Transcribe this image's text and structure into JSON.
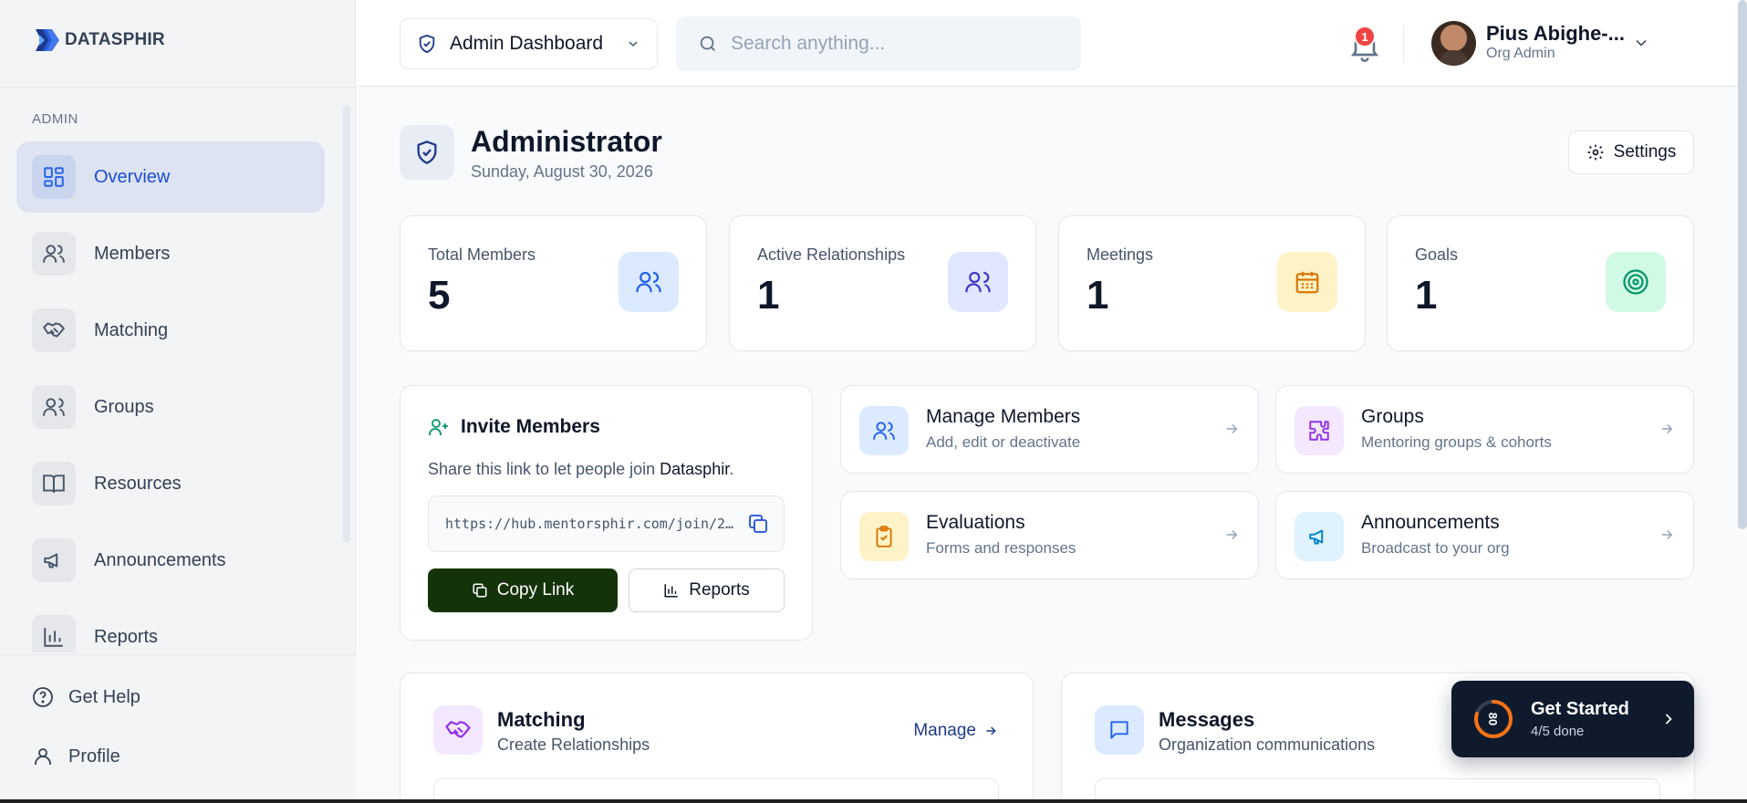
{
  "brand": {
    "name": "DATASPHIR",
    "colors": {
      "primary": "#1d4ed8",
      "dark_green": "#14330a",
      "navy": "#0f1b2d"
    }
  },
  "sidebar": {
    "section_label": "ADMIN",
    "items": [
      {
        "label": "Overview",
        "icon": "grid-icon",
        "active": true
      },
      {
        "label": "Members",
        "icon": "users-icon",
        "active": false
      },
      {
        "label": "Matching",
        "icon": "handshake-icon",
        "active": false
      },
      {
        "label": "Groups",
        "icon": "group-icon",
        "active": false
      },
      {
        "label": "Resources",
        "icon": "book-icon",
        "active": false
      },
      {
        "label": "Announcements",
        "icon": "megaphone-icon",
        "active": false
      },
      {
        "label": "Reports",
        "icon": "bar-chart-icon",
        "active": false
      }
    ],
    "bottom": [
      {
        "label": "Get Help",
        "icon": "help-circle-icon"
      },
      {
        "label": "Profile",
        "icon": "user-icon"
      }
    ]
  },
  "header": {
    "role_select": "Admin Dashboard",
    "search_placeholder": "Search anything...",
    "notifications_count": "1",
    "user": {
      "name": "Pius Abighe-...",
      "role": "Org Admin"
    }
  },
  "page": {
    "title": "Administrator",
    "date": "Sunday, August 30, 2026",
    "settings_label": "Settings"
  },
  "stats": [
    {
      "label": "Total Members",
      "value": "5",
      "icon": "users-icon",
      "bg": "#dbeafe",
      "color": "#2563eb"
    },
    {
      "label": "Active Relationships",
      "value": "1",
      "icon": "people-icon",
      "bg": "#e0e7ff",
      "color": "#4338ca"
    },
    {
      "label": "Meetings",
      "value": "1",
      "icon": "calendar-icon",
      "bg": "#fef3c7",
      "color": "#d97706"
    },
    {
      "label": "Goals",
      "value": "1",
      "icon": "target-icon",
      "bg": "#d1fae5",
      "color": "#059669"
    }
  ],
  "invite": {
    "title": "Invite Members",
    "desc_prefix": "Share this link to let people join ",
    "org_name": "Datasphir",
    "desc_suffix": ".",
    "link": "https://hub.mentorsphir.com/join/2...",
    "copy_label": "Copy Link",
    "reports_label": "Reports"
  },
  "actions": [
    {
      "title": "Manage Members",
      "sub": "Add, edit or deactivate",
      "icon": "users-icon",
      "bg": "#dbeafe",
      "color": "#2563eb"
    },
    {
      "title": "Groups",
      "sub": "Mentoring groups & cohorts",
      "icon": "puzzle-icon",
      "bg": "#f3e8ff",
      "color": "#9333ea"
    },
    {
      "title": "Evaluations",
      "sub": "Forms and responses",
      "icon": "clipboard-icon",
      "bg": "#fef3c7",
      "color": "#d97706"
    },
    {
      "title": "Announcements",
      "sub": "Broadcast to your org",
      "icon": "megaphone-icon",
      "bg": "#e0f2fe",
      "color": "#0284c7"
    }
  ],
  "matching_card": {
    "title": "Matching",
    "sub": "Create Relationships",
    "manage_label": "Manage"
  },
  "messages_card": {
    "title": "Messages",
    "sub": "Organization communications"
  },
  "get_started": {
    "title": "Get Started",
    "sub": "4/5 done",
    "ring_label": "80",
    "progress": 0.8
  }
}
